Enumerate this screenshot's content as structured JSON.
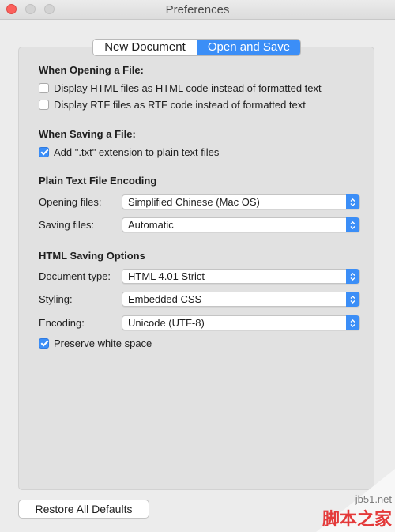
{
  "window": {
    "title": "Preferences"
  },
  "tabs": [
    {
      "label": "New Document",
      "active": false
    },
    {
      "label": "Open and Save",
      "active": true
    }
  ],
  "opening": {
    "title": "When Opening a File:",
    "options": [
      {
        "label": "Display HTML files as HTML code instead of formatted text",
        "checked": false
      },
      {
        "label": "Display RTF files as RTF code instead of formatted text",
        "checked": false
      }
    ]
  },
  "saving": {
    "title": "When Saving a File:",
    "options": [
      {
        "label": "Add \".txt\" extension to plain text files",
        "checked": true
      }
    ]
  },
  "encoding_section": {
    "title": "Plain Text File Encoding",
    "opening_label": "Opening files:",
    "opening_value": "Simplified Chinese (Mac OS)",
    "saving_label": "Saving files:",
    "saving_value": "Automatic"
  },
  "html_section": {
    "title": "HTML Saving Options",
    "doctype_label": "Document type:",
    "doctype_value": "HTML 4.01 Strict",
    "styling_label": "Styling:",
    "styling_value": "Embedded CSS",
    "encoding_label": "Encoding:",
    "encoding_value": "Unicode (UTF-8)",
    "preserve_label": "Preserve white space",
    "preserve_checked": true
  },
  "footer": {
    "restore_label": "Restore All Defaults"
  },
  "watermark": {
    "top": "jb51.net",
    "bottom": "脚本之家"
  },
  "colors": {
    "accent": "#3b8ef7",
    "close": "#fc605c"
  }
}
